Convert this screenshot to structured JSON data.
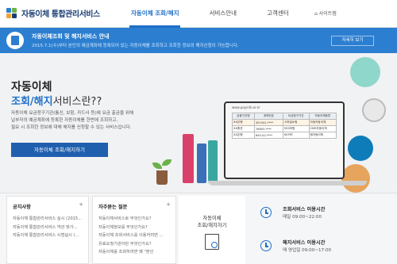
{
  "header": {
    "logo_text": "자동이체 통합관리서비스",
    "nav": [
      "자동이체 조회/해지",
      "서비스안내",
      "고객센터"
    ],
    "login": "사이트맵"
  },
  "notice": {
    "title": "자동이체조회 및 해지서비스 안내",
    "desc": "2015.7.1(수)부터 본인의 예금계좌에 등록되어 있는 자동이체를 조회하고 조회한 정보의 해지신청이 가능합니다.",
    "button": "자세히 보기"
  },
  "hero": {
    "title1": "자동이체",
    "title2_accent": "조회/해지",
    "title2_rest": "서비스란??",
    "desc_lines": [
      "자동이체 요금청구기관(통신, 보험, 카드사 등)에 요금 출금을 위해",
      "납부자의 예금계좌에 등록한 자동이체를 한번에 조회하고,",
      "필요 시 조회한 정보에 대해 해지를 신청할 수 있는 서비스입니다."
    ],
    "button": "자동이체 조회/해지하기",
    "laptop": {
      "url": "www.payinfo.or.kr",
      "headers": [
        "금융기관명",
        "계좌번호",
        "요금청구기관",
        "자동이체종류"
      ],
      "rows": [
        [
          "XX은행",
          "351541-****",
          "스마일쇼핑",
          "자동자동이체"
        ],
        [
          "XX증권",
          "76803-****",
          "SSS보험",
          "CMS자동이체"
        ],
        [
          "XX은행",
          "645-02-****",
          "KK카드",
          "펌자동이체"
        ]
      ]
    }
  },
  "notices_box": {
    "title": "공지사항",
    "more": "+",
    "items": [
      "자동이체 통합관리서비스 실시 (2015...",
      "자동이체 통합관리서비스 약관 및가...",
      "자동이체 통합관리서비스 시범실시 (..."
    ]
  },
  "faq_box": {
    "title": "자주묻는 질문",
    "more": "+",
    "items": [
      "자동이체서비스로 무엇인가요?",
      "자동이체정보를 무엇인가요?",
      "자동이체 조회서비스를 이용하려면 ...",
      "유효요청기관이란 무엇인가요?",
      "자동이체를 조회하려면 왜 \"본인"
    ]
  },
  "center_box": {
    "title_line1": "자동이체",
    "title_line2": "조회/해지하기"
  },
  "hours": [
    {
      "title": "조회서비스 이용시간",
      "time": "매일 09:00~22:00"
    },
    {
      "title": "해지서비스 이용시간",
      "time": "매 영업일 09:00~17:00"
    }
  ],
  "colors": {
    "primary": "#1e6fc8",
    "notice_bg": "#2c7fd0",
    "button_dark": "#1f5fae"
  }
}
